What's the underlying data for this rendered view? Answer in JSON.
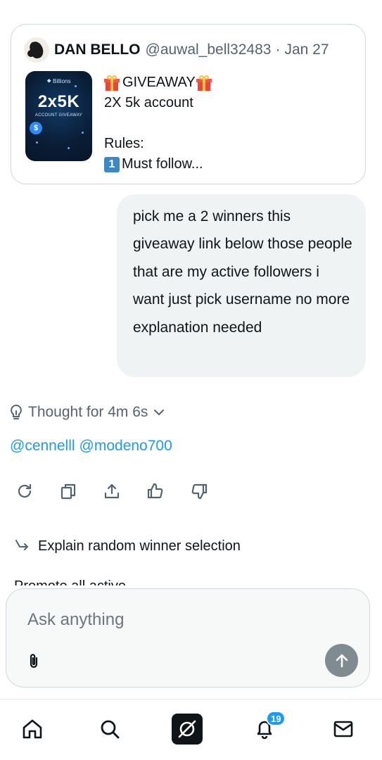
{
  "quote": {
    "author_name": "DAN BELLO",
    "author_handle": "@auwal_bell32483",
    "separator": "·",
    "date": "Jan 27",
    "thumbnail": {
      "brand": "⯁ Billions",
      "big": "2x5K",
      "sub": "ACCOUNT GIVEAWAY",
      "coin": "$"
    },
    "giveaway_title": "GIVEAWAY",
    "line2": "2X 5k account",
    "line4": "Rules:",
    "keycap": "1",
    "line5": "Must follow..."
  },
  "user_message": "pick me a 2 winners  this giveaway link below those people that are my active followers i want just pick username no more explanation needed",
  "thought": {
    "label": "Thought for 4m 6s"
  },
  "answer": {
    "mentions": [
      "@cennelll",
      "@modeno700"
    ]
  },
  "suggestions": [
    {
      "label": "Explain random winner selection"
    },
    {
      "label": "Promote all active..."
    }
  ],
  "composer": {
    "placeholder": "Ask anything"
  },
  "nav": {
    "notification_count": "19"
  },
  "colors": {
    "accent": "#1d9bf0",
    "muted": "#536471",
    "bubble": "#eff3f4",
    "border": "#cfd9de"
  }
}
